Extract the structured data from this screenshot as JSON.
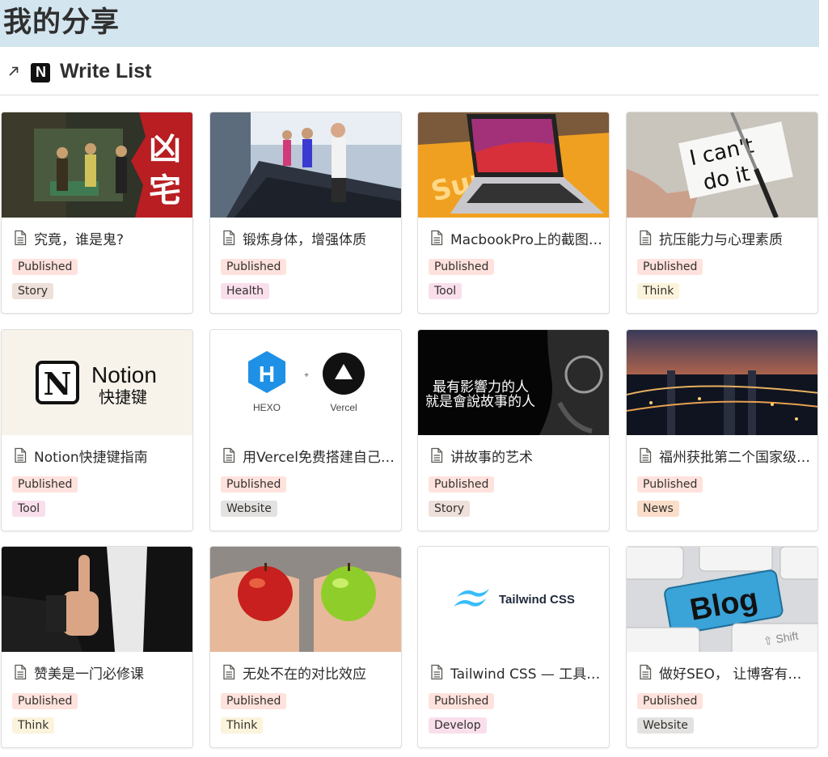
{
  "page": {
    "title": "我的分享"
  },
  "database": {
    "title": "Write List",
    "link_icon": "arrow-up-right-icon",
    "logo_icon": "notion-logo-icon"
  },
  "tag_colors": {
    "Published": "#ffe2dd",
    "Story": "#eee0da",
    "Health": "#f9dfec",
    "Tool": "#f9dfec",
    "Think": "#fbf3db",
    "Website": "#e3e2e0",
    "News": "#fadec9",
    "Develop": "#f9dfec"
  },
  "cards": [
    {
      "title": "究竟，谁是鬼?",
      "status": "Published",
      "category": "Story",
      "cover": "凶宅"
    },
    {
      "title": "锻炼身体，增强体质",
      "status": "Published",
      "category": "Health",
      "cover": ""
    },
    {
      "title": "MacbookPro上的截图技巧",
      "status": "Published",
      "category": "Tool",
      "cover": ""
    },
    {
      "title": "抗压能力与心理素质",
      "status": "Published",
      "category": "Think",
      "cover": "I can't do it"
    },
    {
      "title": "Notion快捷键指南",
      "status": "Published",
      "category": "Tool",
      "cover": "Notion 快捷键"
    },
    {
      "title": "用Vercel免费搭建自己的博客",
      "status": "Published",
      "category": "Website",
      "cover": "HEXO + Vercel"
    },
    {
      "title": "讲故事的艺术",
      "status": "Published",
      "category": "Story",
      "cover": "最有影響力的人 就是會說故事的人"
    },
    {
      "title": "福州获批第二个国家级新区",
      "status": "Published",
      "category": "News",
      "cover": ""
    },
    {
      "title": "赞美是一门必修课",
      "status": "Published",
      "category": "Think",
      "cover": ""
    },
    {
      "title": "无处不在的对比效应",
      "status": "Published",
      "category": "Think",
      "cover": ""
    },
    {
      "title": "Tailwind CSS — 工具优先的CSS框架",
      "status": "Published",
      "category": "Develop",
      "cover": "Tailwind CSS"
    },
    {
      "title": "做好SEO， 让博客有更多访问",
      "status": "Published",
      "category": "Website",
      "cover": "Blog"
    }
  ]
}
